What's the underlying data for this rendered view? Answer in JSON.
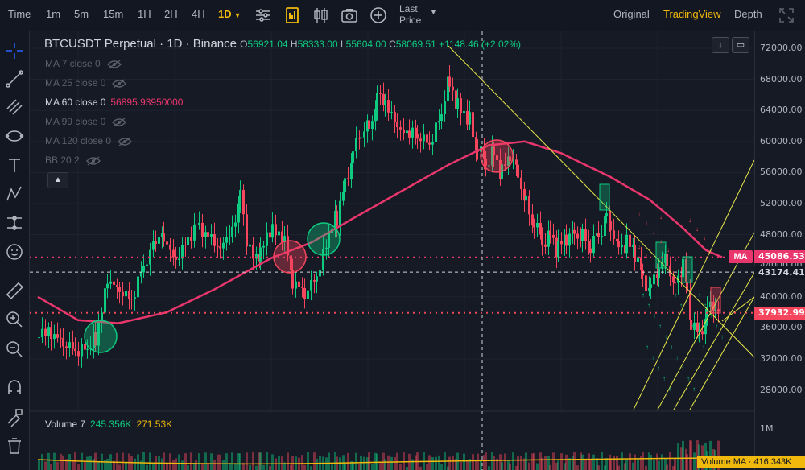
{
  "topbar": {
    "time_label": "Time",
    "intervals": [
      "1m",
      "5m",
      "15m",
      "1H",
      "2H",
      "4H",
      "1D"
    ],
    "active_interval": "1D",
    "last_price_line1": "Last",
    "last_price_line2": "Price",
    "views": [
      "Original",
      "TradingView",
      "Depth"
    ],
    "active_view": "TradingView"
  },
  "legend": {
    "symbol": "BTCUSDT Perpetual · 1D · Binance",
    "o_label": "O",
    "o_value": "56921.04",
    "h_label": "H",
    "h_value": "58333.00",
    "l_label": "L",
    "l_value": "55604.00",
    "c_label": "C",
    "c_value": "58069.51",
    "change": "+1148.46 (+2.02%)"
  },
  "indicators": [
    {
      "label": "MA 7 close 0",
      "visible": false
    },
    {
      "label": "MA 25 close 0",
      "visible": false
    },
    {
      "label": "MA 60 close 0",
      "visible": true,
      "value": "56895.93950000"
    },
    {
      "label": "MA 99 close 0",
      "visible": false
    },
    {
      "label": "MA 120 close 0",
      "visible": false
    },
    {
      "label": "BB 20 2",
      "visible": false
    }
  ],
  "price_axis": [
    "72000.00",
    "68000.00",
    "64000.00",
    "60000.00",
    "56000.00",
    "52000.00",
    "48000.00",
    "44000.00",
    "40000.00",
    "36000.00",
    "32000.00",
    "28000.00"
  ],
  "price_tags": {
    "ma_label": "MA",
    "ma_value": "45086.53",
    "crosshair_value": "43174.41",
    "last_value": "37932.99"
  },
  "volume": {
    "legend_name": "Volume 7",
    "value1": "245.356K",
    "value2": "271.53K",
    "axis_label": "1M",
    "ma_tag": "Volume MA · 416.343K"
  },
  "colors": {
    "up": "#0ecb81",
    "down": "#f6465d",
    "ma": "#e9366d",
    "accent": "#f0b90b",
    "trendline": "#e8e84a"
  },
  "icons": {
    "settings": "sliders-icon",
    "indicators": "document-chart-icon",
    "chart_type": "candles-icon",
    "screenshot": "camera-icon",
    "add": "plus-circle-icon",
    "fullscreen": "expand-icon"
  }
}
